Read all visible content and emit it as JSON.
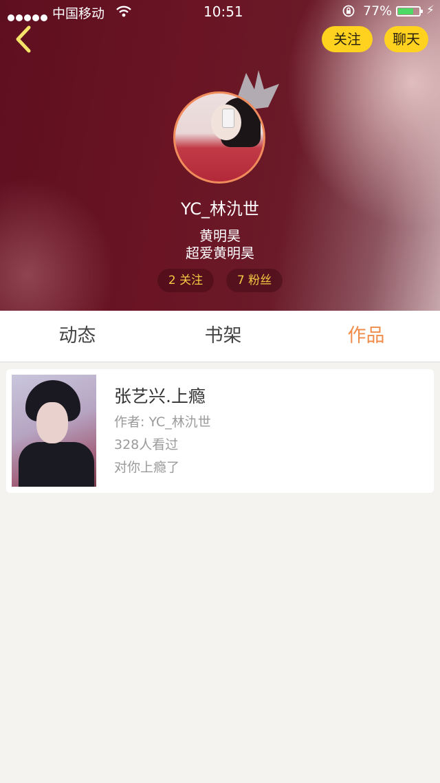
{
  "status_bar": {
    "carrier": "中国移动",
    "time": "10:51",
    "battery": "77%",
    "battery_level": 0.77
  },
  "header": {
    "follow_label": "关注",
    "chat_label": "聊天",
    "username": "YC_林氿世",
    "bio_line1": "黄明昊",
    "bio_line2": "超爱黄明昊",
    "following": "2 关注",
    "fans": "7 粉丝"
  },
  "tabs": [
    {
      "label": "动态",
      "active": false
    },
    {
      "label": "书架",
      "active": false
    },
    {
      "label": "作品",
      "active": true
    }
  ],
  "works": [
    {
      "title": "张艺兴.上瘾",
      "author": "作者: YC_林氿世",
      "views": "328人看过",
      "description": "对你上瘾了"
    }
  ],
  "colors": {
    "accent": "#f08b4a",
    "button_yellow": "#ffd21f",
    "stat_text": "#f5c843",
    "battery_green": "#4cd964"
  }
}
